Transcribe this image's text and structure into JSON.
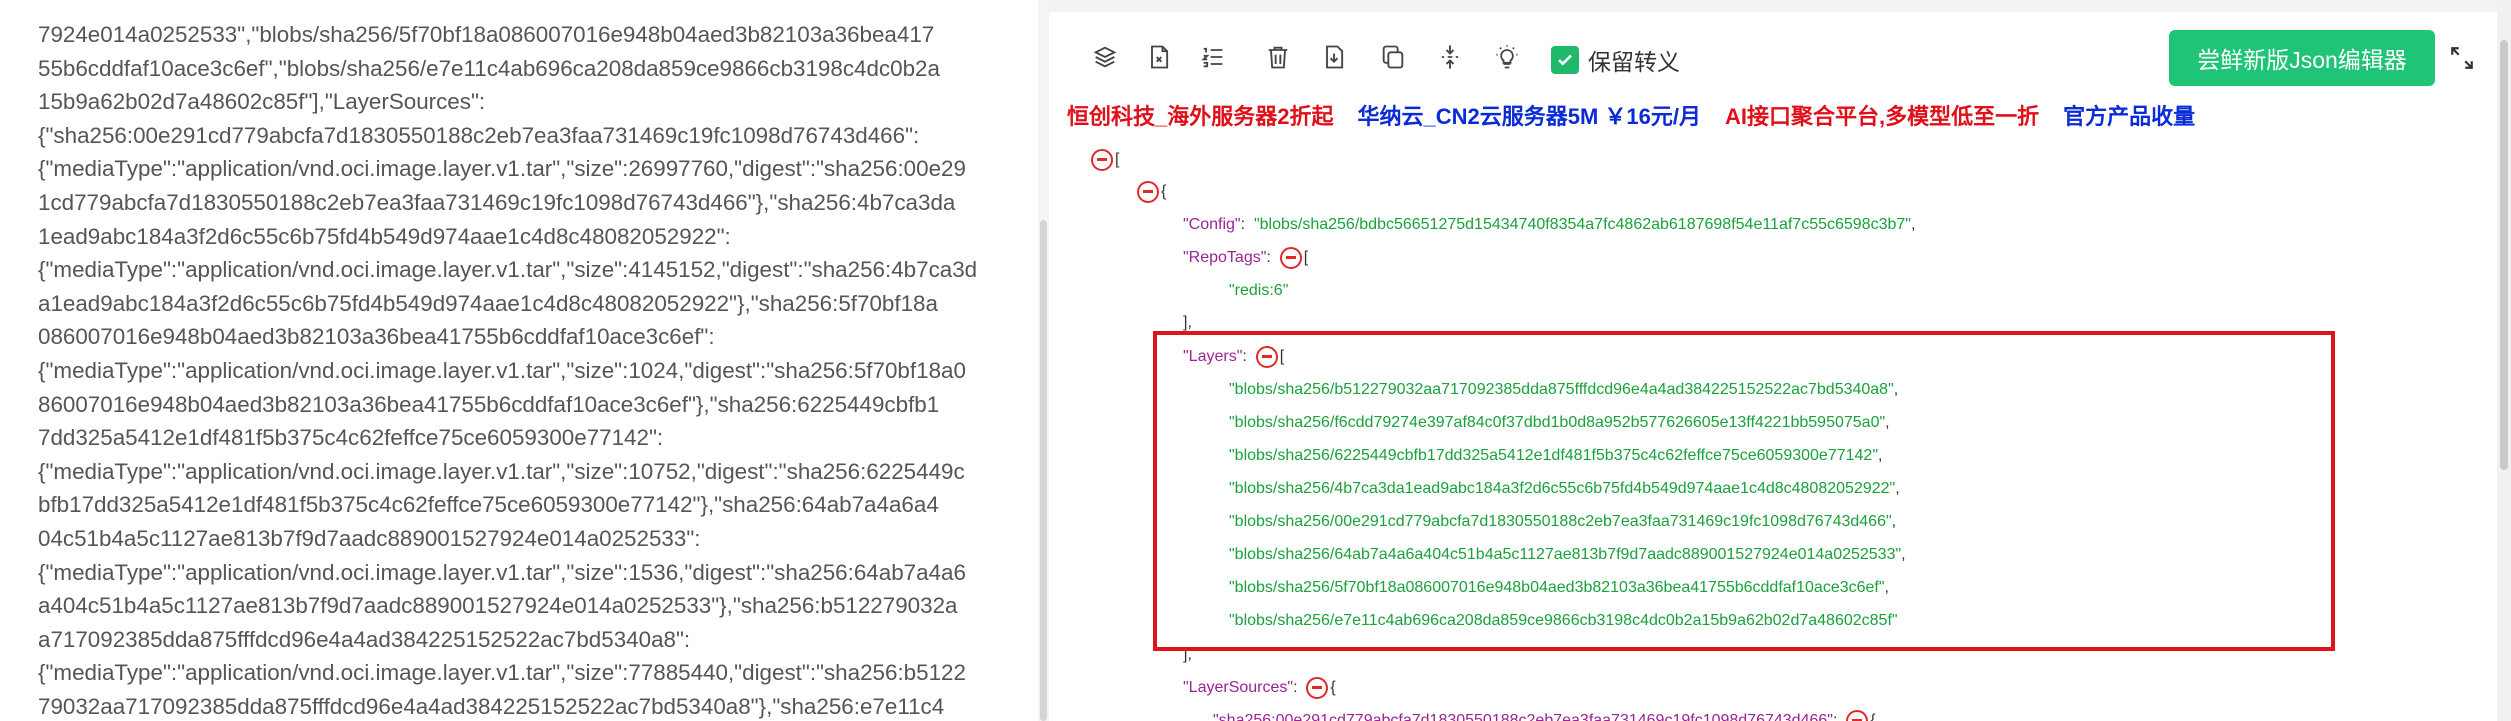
{
  "raw_text_lines": [
    "7924e014a0252533\",\"blobs/sha256/5f70bf18a086007016e948b04aed3b82103a36bea417",
    "55b6cddfaf10ace3c6ef\",\"blobs/sha256/e7e11c4ab696ca208da859ce9866cb3198c4dc0b2a",
    "15b9a62b02d7a48602c85f\"],\"LayerSources\":",
    "{\"sha256:00e291cd779abcfa7d1830550188c2eb7ea3faa731469c19fc1098d76743d466\":",
    "{\"mediaType\":\"application/vnd.oci.image.layer.v1.tar\",\"size\":26997760,\"digest\":\"sha256:00e29",
    "1cd779abcfa7d1830550188c2eb7ea3faa731469c19fc1098d76743d466\"},\"sha256:4b7ca3da",
    "1ead9abc184a3f2d6c55c6b75fd4b549d974aae1c4d8c48082052922\":",
    "{\"mediaType\":\"application/vnd.oci.image.layer.v1.tar\",\"size\":4145152,\"digest\":\"sha256:4b7ca3d",
    "a1ead9abc184a3f2d6c55c6b75fd4b549d974aae1c4d8c48082052922\"},\"sha256:5f70bf18a",
    "086007016e948b04aed3b82103a36bea41755b6cddfaf10ace3c6ef\":",
    "{\"mediaType\":\"application/vnd.oci.image.layer.v1.tar\",\"size\":1024,\"digest\":\"sha256:5f70bf18a0",
    "86007016e948b04aed3b82103a36bea41755b6cddfaf10ace3c6ef\"},\"sha256:6225449cbfb1",
    "7dd325a5412e1df481f5b375c4c62feffce75ce6059300e77142\":",
    "{\"mediaType\":\"application/vnd.oci.image.layer.v1.tar\",\"size\":10752,\"digest\":\"sha256:6225449c",
    "bfb17dd325a5412e1df481f5b375c4c62feffce75ce6059300e77142\"},\"sha256:64ab7a4a6a4",
    "04c51b4a5c1127ae813b7f9d7aadc889001527924e014a0252533\":",
    "{\"mediaType\":\"application/vnd.oci.image.layer.v1.tar\",\"size\":1536,\"digest\":\"sha256:64ab7a4a6",
    "a404c51b4a5c1127ae813b7f9d7aadc889001527924e014a0252533\"},\"sha256:b512279032a",
    "a717092385dda875fffdcd96e4a4ad384225152522ac7bd5340a8\":",
    "{\"mediaType\":\"application/vnd.oci.image.layer.v1.tar\",\"size\":77885440,\"digest\":\"sha256:b5122",
    "79032aa717092385dda875fffdcd96e4a4ad384225152522ac7bd5340a8\"},\"sha256:e7e11c4"
  ],
  "toolbar": {
    "icons": [
      "layers-icon",
      "file-export-icon",
      "list-ordered-icon",
      "trash-icon",
      "download-file-icon",
      "copy-icon",
      "compress-icon",
      "bulb-icon"
    ],
    "checkbox_label": "保留转义",
    "checkbox_checked": true,
    "new_editor_button": "尝鲜新版Json编辑器",
    "accent_color": "#20c477"
  },
  "ads": {
    "a1": "恒创科技_海外服务器2折起",
    "a2": "华纳云_CN2云服务器5M ￥16元/月",
    "a3": "AI接口聚合平台,多模型低至一折",
    "a4": "官方产品收量"
  },
  "tree": {
    "open_bracket": "[",
    "open_brace": "{",
    "config_key": "\"Config\"",
    "config_value": "\"blobs/sha256/bdbc56651275d15434740f8354a7fc4862ab6187698f54e11af7c55c6598c3b7\"",
    "repotags_key": "\"RepoTags\"",
    "repotag_0": "\"redis:6\"",
    "layers_key": "\"Layers\"",
    "layers": [
      "\"blobs/sha256/b512279032aa717092385dda875fffdcd96e4a4ad384225152522ac7bd5340a8\"",
      "\"blobs/sha256/f6cdd79274e397af84c0f37dbd1b0d8a952b577626605e13ff4221bb595075a0\"",
      "\"blobs/sha256/6225449cbfb17dd325a5412e1df481f5b375c4c62feffce75ce6059300e77142\"",
      "\"blobs/sha256/4b7ca3da1ead9abc184a3f2d6c55c6b75fd4b549d974aae1c4d8c48082052922\"",
      "\"blobs/sha256/00e291cd779abcfa7d1830550188c2eb7ea3faa731469c19fc1098d76743d466\"",
      "\"blobs/sha256/64ab7a4a6a404c51b4a5c1127ae813b7f9d7aadc889001527924e014a0252533\"",
      "\"blobs/sha256/5f70bf18a086007016e948b04aed3b82103a36bea41755b6cddfaf10ace3c6ef\"",
      "\"blobs/sha256/e7e11c4ab696ca208da859ce9866cb3198c4dc0b2a15b9a62b02d7a48602c85f\""
    ],
    "layersources_key": "\"LayerSources\"",
    "layersource_0_key": "\"sha256:00e291cd779abcfa7d1830550188c2eb7ea3faa731469c19fc1098d76743d466\""
  }
}
